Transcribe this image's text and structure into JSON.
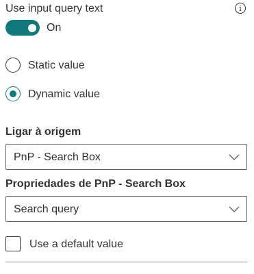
{
  "query_toggle": {
    "label": "Use input query text",
    "info_icon": "info-icon",
    "state_text": "On",
    "checked": true
  },
  "value_type": {
    "options": [
      {
        "label": "Static value",
        "selected": false
      },
      {
        "label": "Dynamic value",
        "selected": true
      }
    ]
  },
  "source": {
    "label": "Ligar à origem",
    "selected": "PnP - Search Box"
  },
  "property": {
    "label": "Propriedades de PnP - Search Box",
    "selected": "Search query"
  },
  "default_value": {
    "label": "Use a default value",
    "checked": false
  },
  "colors": {
    "accent": "#0f7a79",
    "text": "#323130",
    "border": "#605e5c"
  }
}
